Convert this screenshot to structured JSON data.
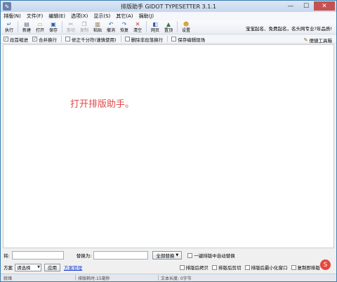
{
  "window": {
    "title": "排版助手 GIDOT TYPESETTER 3.1.1",
    "app_icon": "typesetter-app-icon",
    "controls": [
      "minimize-icon",
      "maximize-icon",
      "close-icon"
    ]
  },
  "menu": [
    "排版(N)",
    "文件(F)",
    "编辑(E)",
    "选项(X)",
    "显示(S)",
    "其它(A)",
    "捐助(J)"
  ],
  "toolbar": {
    "buttons": [
      {
        "label": "执行",
        "icon": "execute-icon",
        "enabled": true
      },
      {
        "label": "新建",
        "icon": "new-file-icon",
        "enabled": true
      },
      {
        "label": "打开",
        "icon": "open-folder-icon",
        "enabled": true
      },
      {
        "label": "保存",
        "icon": "save-icon",
        "enabled": true
      },
      {
        "label": "剪切",
        "icon": "cut-icon",
        "enabled": false
      },
      {
        "label": "复制",
        "icon": "copy-icon",
        "enabled": false
      },
      {
        "label": "粘贴",
        "icon": "paste-icon",
        "enabled": true
      },
      {
        "label": "撤消",
        "icon": "undo-icon",
        "enabled": true
      },
      {
        "label": "恢复",
        "icon": "redo-icon",
        "enabled": true
      },
      {
        "label": "清空",
        "icon": "clear-icon",
        "enabled": true
      },
      {
        "label": "网页",
        "icon": "webpage-icon",
        "enabled": true
      },
      {
        "label": "置顶",
        "icon": "pin-top-icon",
        "enabled": true
      },
      {
        "label": "设置",
        "icon": "settings-icon",
        "enabled": true
      }
    ],
    "right_text": "宝宝起名、免费起名，名头网专业?年品质!"
  },
  "options": [
    {
      "label": "段首缩进",
      "checked": true
    },
    {
      "label": "合并换行",
      "checked": true
    },
    {
      "label": "修正千分符(谨慎使用)",
      "checked": false
    },
    {
      "label": "删除非段落换行",
      "checked": false
    },
    {
      "label": "保存编辑现场",
      "checked": false
    }
  ],
  "toolbox_label": "便捷工具箱",
  "editor": {
    "placeholder": "打开排版助手。"
  },
  "find": {
    "find_label": "将:",
    "replace_label": "替换为:",
    "replace_all_label": "全部替换",
    "auto_replace_label": "一键排版中自动替换"
  },
  "plan": {
    "label": "方案",
    "selected": "请选择",
    "apply_label": "应用",
    "manage_link": "方案管理"
  },
  "bottom_options": [
    {
      "label": "排版后拷贝",
      "checked": false
    },
    {
      "label": "排版后剪切",
      "checked": false
    },
    {
      "label": "排版后最小化窗口",
      "checked": false
    },
    {
      "label": "复制即排版",
      "checked": false
    }
  ],
  "status": {
    "state": "就绪",
    "time": "排版耗时:15毫秒",
    "length": "文本长度: 0字节"
  }
}
